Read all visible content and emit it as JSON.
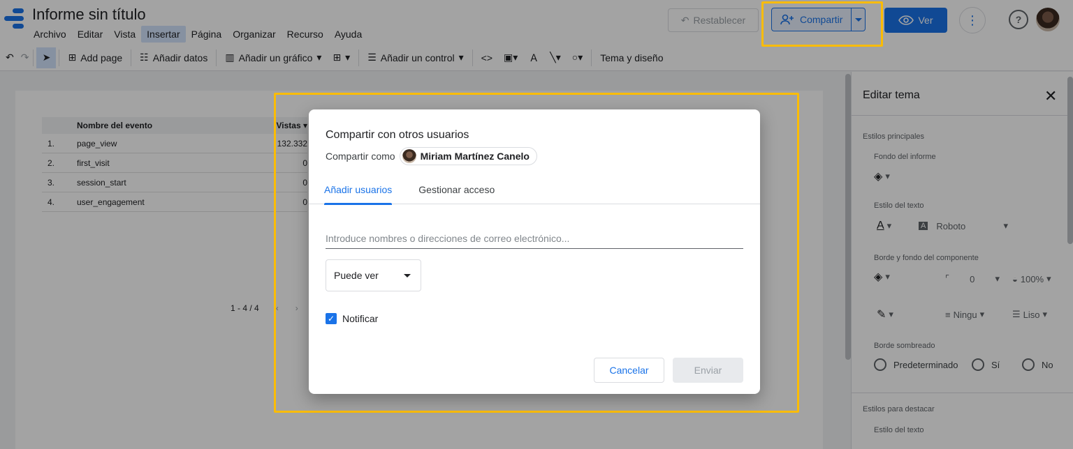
{
  "header": {
    "title": "Informe sin título",
    "menu": [
      "Archivo",
      "Editar",
      "Vista",
      "Insertar",
      "Página",
      "Organizar",
      "Recurso",
      "Ayuda"
    ],
    "reset_label": "Restablecer",
    "share_label": "Compartir",
    "view_label": "Ver"
  },
  "toolbar": {
    "add_page": "Add page",
    "add_data": "Añadir datos",
    "add_chart": "Añadir un gráfico",
    "add_control": "Añadir un control",
    "theme": "Tema y diseño"
  },
  "table": {
    "headers": [
      "Nombre del evento",
      "Vistas"
    ],
    "rows": [
      {
        "num": "1.",
        "name": "page_view",
        "val": "132.332"
      },
      {
        "num": "2.",
        "name": "first_visit",
        "val": "0"
      },
      {
        "num": "3.",
        "name": "session_start",
        "val": "0"
      },
      {
        "num": "4.",
        "name": "user_engagement",
        "val": "0"
      }
    ],
    "pager": "1 - 4 / 4"
  },
  "panel": {
    "title": "Editar tema",
    "main_styles": "Estilos principales",
    "report_bg": "Fondo del informe",
    "text_style": "Estilo del texto",
    "font": "Roboto",
    "border_bg": "Borde y fondo del componente",
    "radius": "0",
    "opacity": "100%",
    "border_weight": "Ningu",
    "border_style": "Liso",
    "shadow": "Borde sombreado",
    "shadow_options": [
      "Predeterminado",
      "Sí",
      "No"
    ],
    "highlight_styles": "Estilos para destacar",
    "text_style2": "Estilo del texto"
  },
  "dialog": {
    "title": "Compartir con otros usuarios",
    "share_as_label": "Compartir como",
    "user_name": "Miriam Martínez Canelo",
    "tabs": [
      "Añadir usuarios",
      "Gestionar acceso"
    ],
    "input_placeholder": "Introduce nombres o direcciones de correo electrónico...",
    "permission": "Puede ver",
    "notify_label": "Notificar",
    "cancel_label": "Cancelar",
    "send_label": "Enviar"
  },
  "colors": {
    "accent": "#1a73e8",
    "highlight": "#fbbc04"
  }
}
